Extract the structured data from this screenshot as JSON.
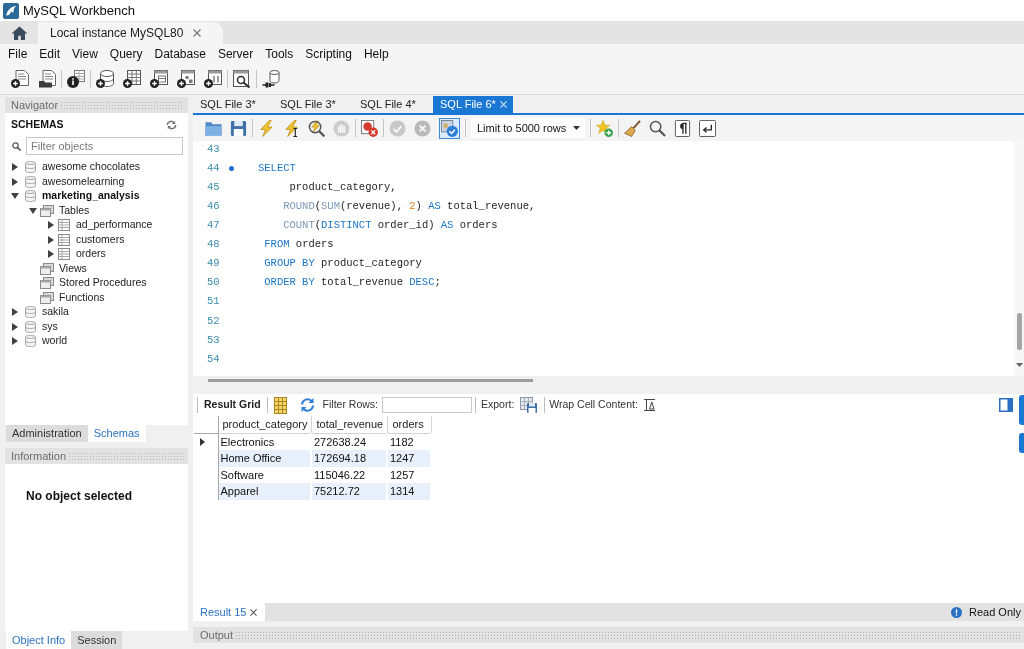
{
  "window": {
    "title": "MySQL Workbench"
  },
  "connection_tabs": [
    {
      "kind": "home",
      "selected": false
    },
    {
      "kind": "connection",
      "label": "Local instance MySQL80",
      "selected": true
    }
  ],
  "menu": [
    "File",
    "Edit",
    "View",
    "Query",
    "Database",
    "Server",
    "Tools",
    "Scripting",
    "Help"
  ],
  "main_toolbar": [
    [
      {
        "kind": "new-sql"
      },
      {
        "kind": "open-sql"
      }
    ],
    [
      {
        "kind": "inspector"
      }
    ],
    [
      {
        "kind": "create-schema"
      },
      {
        "kind": "create-table"
      },
      {
        "kind": "create-view"
      },
      {
        "kind": "create-procedure"
      },
      {
        "kind": "create-function"
      }
    ],
    [
      {
        "kind": "search-data"
      }
    ],
    [
      {
        "kind": "reconnect"
      }
    ]
  ],
  "navigator": {
    "title": "Navigator",
    "heading": "SCHEMAS",
    "filter": {
      "placeholder": "Filter objects"
    },
    "schemas": [
      {
        "kind": "schema",
        "label": "awesome chocolates",
        "expanded": false,
        "default": false
      },
      {
        "kind": "schema",
        "label": "awesomelearning",
        "expanded": false,
        "default": false
      },
      {
        "kind": "schema",
        "label": "marketing_analysis",
        "expanded": true,
        "default": true,
        "children": [
          {
            "kind": "folder",
            "label": "Tables",
            "expanded": true,
            "children": [
              {
                "kind": "table",
                "label": "ad_performance",
                "expanded": false
              },
              {
                "kind": "table",
                "label": "customers",
                "expanded": false
              },
              {
                "kind": "table",
                "label": "orders",
                "expanded": false
              }
            ]
          },
          {
            "kind": "folder",
            "label": "Views"
          },
          {
            "kind": "folder",
            "label": "Stored Procedures"
          },
          {
            "kind": "folder",
            "label": "Functions"
          }
        ]
      },
      {
        "kind": "schema",
        "label": "sakila",
        "expanded": false,
        "default": false
      },
      {
        "kind": "schema",
        "label": "sys",
        "expanded": false,
        "default": false
      },
      {
        "kind": "schema",
        "label": "world",
        "expanded": false,
        "default": false
      }
    ]
  },
  "navigator_tabs": [
    {
      "label": "Administration",
      "selected": false
    },
    {
      "label": "Schemas",
      "selected": true
    }
  ],
  "information": {
    "title": "Information",
    "message": "No object selected"
  },
  "information_tabs": [
    {
      "label": "Object Info",
      "selected": true
    },
    {
      "label": "Session",
      "selected": false
    }
  ],
  "editor_tabs": [
    {
      "label": "SQL File 3*",
      "selected": false
    },
    {
      "label": "SQL File 3*",
      "selected": false
    },
    {
      "label": "SQL File 4*",
      "selected": false
    },
    {
      "label": "SQL File 6*",
      "selected": true
    }
  ],
  "editor_toolbar": [
    [
      {
        "kind": "open-file",
        "disabled": false,
        "pressed": false
      },
      {
        "kind": "save",
        "disabled": false,
        "pressed": false
      }
    ],
    [
      {
        "kind": "execute",
        "disabled": false,
        "pressed": false
      },
      {
        "kind": "execute-current",
        "disabled": false,
        "pressed": false
      },
      {
        "kind": "explain",
        "disabled": false,
        "pressed": false
      },
      {
        "kind": "stop",
        "disabled": true,
        "pressed": false
      }
    ],
    [
      {
        "kind": "stop-on-error",
        "disabled": false,
        "pressed": false
      }
    ],
    [
      {
        "kind": "commit",
        "disabled": true,
        "pressed": false
      },
      {
        "kind": "rollback",
        "disabled": true,
        "pressed": false
      },
      {
        "kind": "autocommit",
        "disabled": false,
        "pressed": true
      }
    ],
    [
      {
        "kind": "limit-select",
        "value": "Limit to 5000 rows"
      }
    ],
    [
      {
        "kind": "snippet",
        "disabled": false,
        "pressed": false
      }
    ],
    [
      {
        "kind": "beautify",
        "disabled": false,
        "pressed": false
      },
      {
        "kind": "find",
        "disabled": false,
        "pressed": false
      },
      {
        "kind": "invisibles",
        "disabled": false,
        "pressed": false
      },
      {
        "kind": "wrap-lines",
        "disabled": false,
        "pressed": false
      }
    ]
  ],
  "editor": {
    "lines": [
      {
        "number": "43",
        "marker": false
      },
      {
        "number": "44",
        "marker": true,
        "tokens": [
          {
            "kind": "keyword",
            "text": "SELECT"
          }
        ]
      },
      {
        "number": "45",
        "marker": false,
        "tokens": [
          {
            "kind": "text",
            "text": "     product_category,"
          }
        ]
      },
      {
        "number": "46",
        "marker": false,
        "tokens": [
          {
            "kind": "function",
            "text": "    ROUND"
          },
          {
            "kind": "text",
            "text": "("
          },
          {
            "kind": "function",
            "text": "SUM"
          },
          {
            "kind": "text",
            "text": "(revenue), "
          },
          {
            "kind": "number",
            "text": "2"
          },
          {
            "kind": "text",
            "text": ") "
          },
          {
            "kind": "keyword",
            "text": "AS"
          },
          {
            "kind": "text",
            "text": " total_revenue,"
          }
        ]
      },
      {
        "number": "47",
        "marker": false,
        "tokens": [
          {
            "kind": "function",
            "text": "    COUNT"
          },
          {
            "kind": "text",
            "text": "("
          },
          {
            "kind": "keyword",
            "text": "DISTINCT"
          },
          {
            "kind": "text",
            "text": " order_id) "
          },
          {
            "kind": "keyword",
            "text": "AS"
          },
          {
            "kind": "text",
            "text": " orders"
          }
        ]
      },
      {
        "number": "48",
        "marker": false,
        "tokens": [
          {
            "kind": "keyword",
            "text": " FROM"
          },
          {
            "kind": "text",
            "text": " orders"
          }
        ]
      },
      {
        "number": "49",
        "marker": false,
        "tokens": [
          {
            "kind": "keyword",
            "text": " GROUP BY"
          },
          {
            "kind": "text",
            "text": " product_category"
          }
        ]
      },
      {
        "number": "50",
        "marker": false,
        "tokens": [
          {
            "kind": "keyword",
            "text": " ORDER BY"
          },
          {
            "kind": "text",
            "text": " total_revenue "
          },
          {
            "kind": "keyword",
            "text": "DESC"
          },
          {
            "kind": "text",
            "text": ";"
          }
        ]
      },
      {
        "number": "51",
        "marker": false
      },
      {
        "number": "52",
        "marker": false
      },
      {
        "number": "53",
        "marker": false
      },
      {
        "number": "54",
        "marker": false
      }
    ]
  },
  "result_toolbar": {
    "title": "Result Grid",
    "filter_label": "Filter Rows:",
    "export_label": "Export:",
    "wrap_label": "Wrap Cell Content:"
  },
  "result_grid": {
    "columns": [
      "product_category",
      "total_revenue",
      "orders"
    ],
    "rows": [
      {
        "selected": true,
        "cells": [
          "Electronics",
          "272638.24",
          "1182"
        ]
      },
      {
        "selected": false,
        "cells": [
          "Home Office",
          "172694.18",
          "1247"
        ]
      },
      {
        "selected": false,
        "cells": [
          "Software",
          "115046.22",
          "1257"
        ]
      },
      {
        "selected": false,
        "cells": [
          "Apparel",
          "75212.72",
          "1314"
        ]
      }
    ]
  },
  "result_tabs": [
    {
      "label": "Result 15",
      "selected": true
    }
  ],
  "status": "Read Only",
  "output": {
    "title": "Output"
  }
}
